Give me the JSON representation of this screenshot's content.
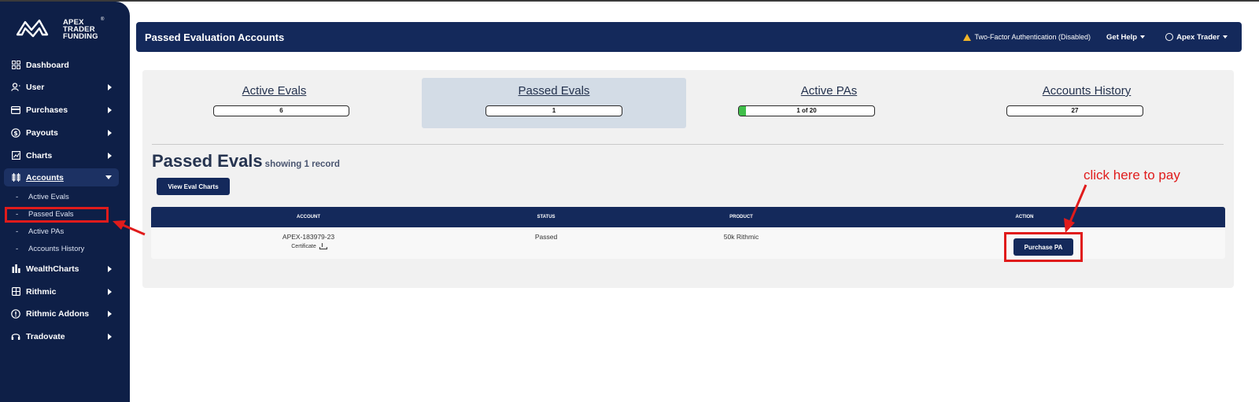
{
  "brand": {
    "name_lines": [
      "APEX",
      "TRADER",
      "FUNDING"
    ],
    "registered": "®"
  },
  "sidebar": {
    "items": [
      {
        "label": "Dashboard",
        "icon": "dashboard-icon",
        "has_caret": false
      },
      {
        "label": "User",
        "icon": "user-icon",
        "has_caret": true
      },
      {
        "label": "Purchases",
        "icon": "card-icon",
        "has_caret": true
      },
      {
        "label": "Payouts",
        "icon": "dollar-icon",
        "has_caret": true
      },
      {
        "label": "Charts",
        "icon": "chart-icon",
        "has_caret": true
      },
      {
        "label": "Accounts",
        "icon": "accounts-icon",
        "has_caret": true,
        "active": true
      },
      {
        "label": "WealthCharts",
        "icon": "bars-icon",
        "has_caret": true
      },
      {
        "label": "Rithmic",
        "icon": "grid-icon",
        "has_caret": true
      },
      {
        "label": "Rithmic Addons",
        "icon": "info-icon",
        "has_caret": true
      },
      {
        "label": "Tradovate",
        "icon": "headset-icon",
        "has_caret": true
      }
    ],
    "sub_items": [
      {
        "label": "Active Evals"
      },
      {
        "label": "Passed Evals",
        "highlighted": true
      },
      {
        "label": "Active PAs"
      },
      {
        "label": "Accounts History"
      }
    ],
    "sub_dash": "-"
  },
  "header": {
    "title": "Passed Evaluation Accounts",
    "two_factor": "Two-Factor Authentication (Disabled)",
    "help": "Get Help",
    "user": "Apex Trader"
  },
  "stats": [
    {
      "title": "Active Evals",
      "value": "6",
      "progress": null
    },
    {
      "title": "Passed Evals",
      "value": "1",
      "progress": null,
      "selected": true
    },
    {
      "title": "Active PAs",
      "value": "1 of 20",
      "progress": 0.05
    },
    {
      "title": "Accounts History",
      "value": "27",
      "progress": null
    }
  ],
  "section": {
    "title": "Passed Evals",
    "subtitle": "showing 1 record",
    "view_charts_button": "View Eval Charts"
  },
  "table": {
    "columns": [
      "ACCOUNT",
      "STATUS",
      "PRODUCT",
      "ACTION"
    ],
    "rows": [
      {
        "account": "APEX-183979-23",
        "certificate": "Certificate",
        "status": "Passed",
        "product": "50k Rithmic",
        "action": "Purchase PA"
      }
    ]
  },
  "annotation": {
    "text": "click here to pay",
    "color": "#e01b1b"
  },
  "colors": {
    "sidebar": "#0e1f47",
    "header": "#14295b",
    "accent_green": "#40bf4a",
    "warning": "#f0b429"
  }
}
